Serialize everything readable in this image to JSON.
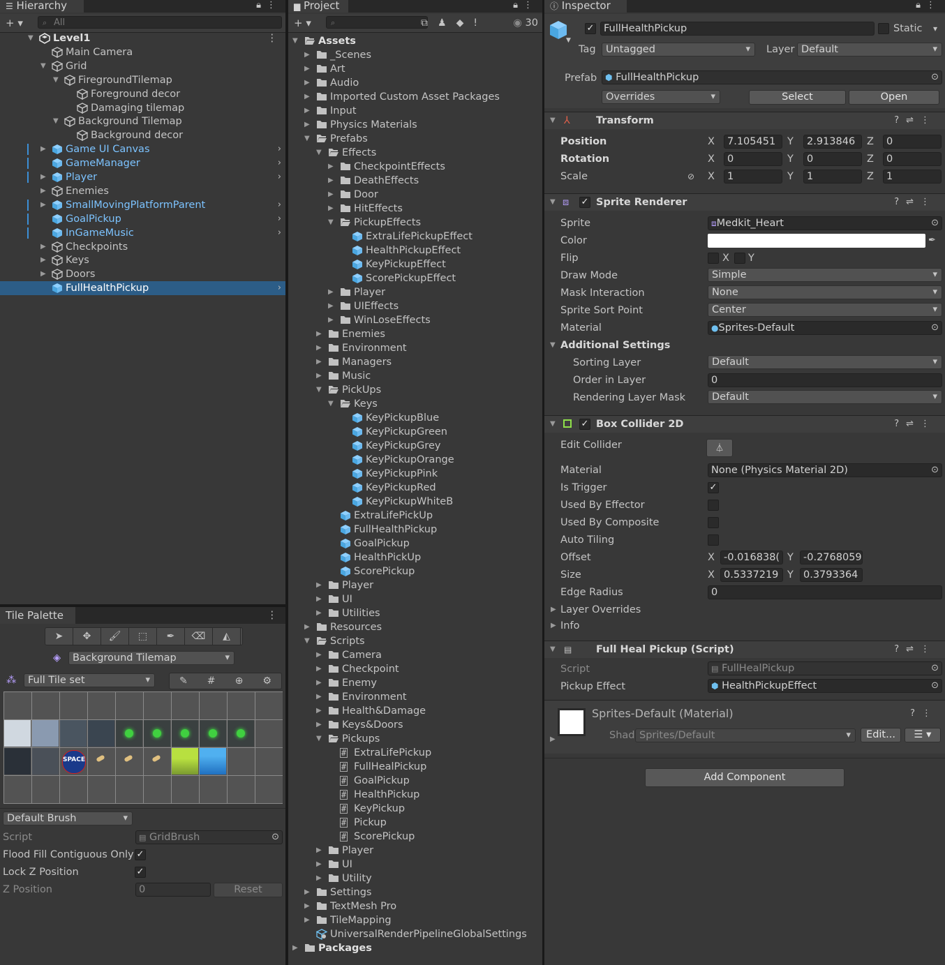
{
  "hierarchy": {
    "tab_title": "Hierarchy",
    "search_placeholder": "All",
    "items": [
      {
        "label": "Level1",
        "depth": 0,
        "arrow": "▼",
        "icon": "unity-scene-icon",
        "bold": true,
        "menu": true
      },
      {
        "label": "Main Camera",
        "depth": 1,
        "arrow": "",
        "icon": "gameobject-icon"
      },
      {
        "label": "Grid",
        "depth": 1,
        "arrow": "▼",
        "icon": "gameobject-icon"
      },
      {
        "label": "FiregroundTilemap",
        "depth": 2,
        "arrow": "▼",
        "icon": "gameobject-icon"
      },
      {
        "label": "Foreground decor",
        "depth": 3,
        "arrow": "",
        "icon": "gameobject-icon"
      },
      {
        "label": "Damaging tilemap",
        "depth": 3,
        "arrow": "",
        "icon": "gameobject-icon"
      },
      {
        "label": "Background Tilemap",
        "depth": 2,
        "arrow": "▼",
        "icon": "gameobject-icon"
      },
      {
        "label": "Background decor",
        "depth": 3,
        "arrow": "",
        "icon": "gameobject-icon"
      },
      {
        "label": "Game UI Canvas",
        "depth": 1,
        "arrow": "▶",
        "icon": "prefab-icon",
        "prefab": true,
        "chevron": true
      },
      {
        "label": "GameManager",
        "depth": 1,
        "arrow": "",
        "icon": "prefab-icon",
        "prefab": true,
        "chevron": true
      },
      {
        "label": "Player",
        "depth": 1,
        "arrow": "▶",
        "icon": "prefab-icon",
        "prefab": true,
        "chevron": true
      },
      {
        "label": "Enemies",
        "depth": 1,
        "arrow": "▶",
        "icon": "gameobject-icon"
      },
      {
        "label": "SmallMovingPlatformParent",
        "depth": 1,
        "arrow": "▶",
        "icon": "prefab-icon",
        "prefab": true,
        "chevron": true
      },
      {
        "label": "GoalPickup",
        "depth": 1,
        "arrow": "",
        "icon": "prefab-icon",
        "prefab": true,
        "chevron": true
      },
      {
        "label": "InGameMusic",
        "depth": 1,
        "arrow": "",
        "icon": "prefab-icon",
        "prefab": true,
        "chevron": true
      },
      {
        "label": "Checkpoints",
        "depth": 1,
        "arrow": "▶",
        "icon": "gameobject-icon"
      },
      {
        "label": "Keys",
        "depth": 1,
        "arrow": "▶",
        "icon": "gameobject-icon"
      },
      {
        "label": "Doors",
        "depth": 1,
        "arrow": "▶",
        "icon": "gameobject-icon"
      },
      {
        "label": "FullHealthPickup",
        "depth": 1,
        "arrow": "",
        "icon": "prefab-icon",
        "selected": true,
        "chevron": true
      }
    ]
  },
  "tile_palette": {
    "tab_title": "Tile Palette",
    "tools": [
      "select-tool-icon",
      "move-tool-icon",
      "paint-tool-icon",
      "box-fill-tool-icon",
      "picker-tool-icon",
      "eraser-tool-icon",
      "fill-tool-icon"
    ],
    "target_tilemap": "Background Tilemap",
    "palette_name": "Full Tile set",
    "brush": "Default Brush",
    "script_label": "Script",
    "script_value": "GridBrush",
    "flood_fill_label": "Flood Fill Contiguous Only",
    "flood_fill": true,
    "lock_z_label": "Lock Z Position",
    "lock_z": true,
    "z_position_label": "Z Position",
    "z_position": "0",
    "reset_label": "Reset",
    "tile_badge": "SPACE"
  },
  "project": {
    "tab_title": "Project",
    "visible_count": "30",
    "items": [
      {
        "label": "Assets",
        "depth": 0,
        "arrow": "▼",
        "type": "folder-open",
        "bold": true
      },
      {
        "label": "_Scenes",
        "depth": 1,
        "arrow": "▶",
        "type": "folder"
      },
      {
        "label": "Art",
        "depth": 1,
        "arrow": "▶",
        "type": "folder"
      },
      {
        "label": "Audio",
        "depth": 1,
        "arrow": "▶",
        "type": "folder"
      },
      {
        "label": "Imported Custom Asset Packages",
        "depth": 1,
        "arrow": "▶",
        "type": "folder"
      },
      {
        "label": "Input",
        "depth": 1,
        "arrow": "▶",
        "type": "folder"
      },
      {
        "label": "Physics Materials",
        "depth": 1,
        "arrow": "▶",
        "type": "folder"
      },
      {
        "label": "Prefabs",
        "depth": 1,
        "arrow": "▼",
        "type": "folder-open"
      },
      {
        "label": "Effects",
        "depth": 2,
        "arrow": "▼",
        "type": "folder-open"
      },
      {
        "label": "CheckpointEffects",
        "depth": 3,
        "arrow": "▶",
        "type": "folder"
      },
      {
        "label": "DeathEffects",
        "depth": 3,
        "arrow": "▶",
        "type": "folder"
      },
      {
        "label": "Door",
        "depth": 3,
        "arrow": "▶",
        "type": "folder"
      },
      {
        "label": "HitEffects",
        "depth": 3,
        "arrow": "▶",
        "type": "folder"
      },
      {
        "label": "PickupEffects",
        "depth": 3,
        "arrow": "▼",
        "type": "folder-open"
      },
      {
        "label": "ExtraLifePickupEffect",
        "depth": 4,
        "arrow": "",
        "type": "prefab"
      },
      {
        "label": "HealthPickupEffect",
        "depth": 4,
        "arrow": "",
        "type": "prefab"
      },
      {
        "label": "KeyPickupEffect",
        "depth": 4,
        "arrow": "",
        "type": "prefab"
      },
      {
        "label": "ScorePickupEffect",
        "depth": 4,
        "arrow": "",
        "type": "prefab"
      },
      {
        "label": "Player",
        "depth": 3,
        "arrow": "▶",
        "type": "folder"
      },
      {
        "label": "UIEffects",
        "depth": 3,
        "arrow": "▶",
        "type": "folder"
      },
      {
        "label": "WinLoseEffects",
        "depth": 3,
        "arrow": "▶",
        "type": "folder"
      },
      {
        "label": "Enemies",
        "depth": 2,
        "arrow": "▶",
        "type": "folder"
      },
      {
        "label": "Environment",
        "depth": 2,
        "arrow": "▶",
        "type": "folder"
      },
      {
        "label": "Managers",
        "depth": 2,
        "arrow": "▶",
        "type": "folder"
      },
      {
        "label": "Music",
        "depth": 2,
        "arrow": "▶",
        "type": "folder"
      },
      {
        "label": "PickUps",
        "depth": 2,
        "arrow": "▼",
        "type": "folder-open"
      },
      {
        "label": "Keys",
        "depth": 3,
        "arrow": "▼",
        "type": "folder-open"
      },
      {
        "label": "KeyPickupBlue",
        "depth": 4,
        "arrow": "",
        "type": "prefab"
      },
      {
        "label": "KeyPickupGreen",
        "depth": 4,
        "arrow": "",
        "type": "prefab"
      },
      {
        "label": "KeyPickupGrey",
        "depth": 4,
        "arrow": "",
        "type": "prefab"
      },
      {
        "label": "KeyPickupOrange",
        "depth": 4,
        "arrow": "",
        "type": "prefab"
      },
      {
        "label": "KeyPickupPink",
        "depth": 4,
        "arrow": "",
        "type": "prefab"
      },
      {
        "label": "KeyPickupRed",
        "depth": 4,
        "arrow": "",
        "type": "prefab"
      },
      {
        "label": "KeyPickupWhiteB",
        "depth": 4,
        "arrow": "",
        "type": "prefab"
      },
      {
        "label": "ExtraLifePickUp",
        "depth": 3,
        "arrow": "",
        "type": "prefab"
      },
      {
        "label": "FullHealthPickup",
        "depth": 3,
        "arrow": "",
        "type": "prefab"
      },
      {
        "label": "GoalPickup",
        "depth": 3,
        "arrow": "",
        "type": "prefab"
      },
      {
        "label": "HealthPickUp",
        "depth": 3,
        "arrow": "",
        "type": "prefab"
      },
      {
        "label": "ScorePickup",
        "depth": 3,
        "arrow": "",
        "type": "prefab"
      },
      {
        "label": "Player",
        "depth": 2,
        "arrow": "▶",
        "type": "folder"
      },
      {
        "label": "UI",
        "depth": 2,
        "arrow": "▶",
        "type": "folder"
      },
      {
        "label": "Utilities",
        "depth": 2,
        "arrow": "▶",
        "type": "folder"
      },
      {
        "label": "Resources",
        "depth": 1,
        "arrow": "▶",
        "type": "folder"
      },
      {
        "label": "Scripts",
        "depth": 1,
        "arrow": "▼",
        "type": "folder-open"
      },
      {
        "label": "Camera",
        "depth": 2,
        "arrow": "▶",
        "type": "folder"
      },
      {
        "label": "Checkpoint",
        "depth": 2,
        "arrow": "▶",
        "type": "folder"
      },
      {
        "label": "Enemy",
        "depth": 2,
        "arrow": "▶",
        "type": "folder"
      },
      {
        "label": "Environment",
        "depth": 2,
        "arrow": "▶",
        "type": "folder"
      },
      {
        "label": "Health&Damage",
        "depth": 2,
        "arrow": "▶",
        "type": "folder"
      },
      {
        "label": "Keys&Doors",
        "depth": 2,
        "arrow": "▶",
        "type": "folder"
      },
      {
        "label": "Pickups",
        "depth": 2,
        "arrow": "▼",
        "type": "folder-open"
      },
      {
        "label": "ExtraLifePickup",
        "depth": 3,
        "arrow": "",
        "type": "script"
      },
      {
        "label": "FullHealPickup",
        "depth": 3,
        "arrow": "",
        "type": "script"
      },
      {
        "label": "GoalPickup",
        "depth": 3,
        "arrow": "",
        "type": "script"
      },
      {
        "label": "HealthPickup",
        "depth": 3,
        "arrow": "",
        "type": "script"
      },
      {
        "label": "KeyPickup",
        "depth": 3,
        "arrow": "",
        "type": "script"
      },
      {
        "label": "Pickup",
        "depth": 3,
        "arrow": "",
        "type": "script"
      },
      {
        "label": "ScorePickup",
        "depth": 3,
        "arrow": "",
        "type": "script"
      },
      {
        "label": "Player",
        "depth": 2,
        "arrow": "▶",
        "type": "folder"
      },
      {
        "label": "UI",
        "depth": 2,
        "arrow": "▶",
        "type": "folder"
      },
      {
        "label": "Utility",
        "depth": 2,
        "arrow": "▶",
        "type": "folder"
      },
      {
        "label": "Settings",
        "depth": 1,
        "arrow": "▶",
        "type": "folder"
      },
      {
        "label": "TextMesh Pro",
        "depth": 1,
        "arrow": "▶",
        "type": "folder"
      },
      {
        "label": "TileMapping",
        "depth": 1,
        "arrow": "▶",
        "type": "folder"
      },
      {
        "label": "UniversalRenderPipelineGlobalSettings",
        "depth": 1,
        "arrow": "",
        "type": "asset"
      },
      {
        "label": "Packages",
        "depth": 0,
        "arrow": "▶",
        "type": "folder",
        "bold": true
      }
    ]
  },
  "inspector": {
    "tab_title": "Inspector",
    "object_name": "FullHealthPickup",
    "active": true,
    "static_label": "Static",
    "static": false,
    "tag_label": "Tag",
    "tag": "Untagged",
    "layer_label": "Layer",
    "layer": "Default",
    "prefab_label": "Prefab",
    "prefab_value": "FullHealthPickup",
    "overrides_label": "Overrides",
    "select_label": "Select",
    "open_label": "Open",
    "transform": {
      "title": "Transform",
      "position_label": "Position",
      "position": {
        "x": "7.105451",
        "y": "2.913846",
        "z": "0"
      },
      "rotation_label": "Rotation",
      "rotation": {
        "x": "0",
        "y": "0",
        "z": "0"
      },
      "scale_label": "Scale",
      "scale": {
        "x": "1",
        "y": "1",
        "z": "1"
      }
    },
    "sprite_renderer": {
      "title": "Sprite Renderer",
      "enabled": true,
      "sprite_label": "Sprite",
      "sprite": "Medkit_Heart",
      "color_label": "Color",
      "color": "#ffffff",
      "flip_label": "Flip",
      "flip_x_label": "X",
      "flip_y_label": "Y",
      "draw_mode_label": "Draw Mode",
      "draw_mode": "Simple",
      "mask_label": "Mask Interaction",
      "mask": "None",
      "sort_point_label": "Sprite Sort Point",
      "sort_point": "Center",
      "material_label": "Material",
      "material": "Sprites-Default",
      "additional_label": "Additional Settings",
      "sorting_layer_label": "Sorting Layer",
      "sorting_layer": "Default",
      "order_label": "Order in Layer",
      "order": "0",
      "rlm_label": "Rendering Layer Mask",
      "rlm": "Default"
    },
    "box_collider": {
      "title": "Box Collider 2D",
      "enabled": true,
      "edit_label": "Edit Collider",
      "material_label": "Material",
      "material": "None (Physics Material 2D)",
      "trigger_label": "Is Trigger",
      "trigger": true,
      "effector_label": "Used By Effector",
      "effector": false,
      "composite_label": "Used By Composite",
      "composite": false,
      "tiling_label": "Auto Tiling",
      "tiling": false,
      "offset_label": "Offset",
      "offset": {
        "x": "-0.016838(",
        "y": "-0.2768059"
      },
      "size_label": "Size",
      "size": {
        "x": "0.5337219",
        "y": "0.3793364"
      },
      "radius_label": "Edge Radius",
      "radius": "0",
      "layer_overrides_label": "Layer Overrides",
      "info_label": "Info"
    },
    "script": {
      "title": "Full Heal Pickup (Script)",
      "script_label": "Script",
      "script": "FullHealPickup",
      "effect_label": "Pickup Effect",
      "effect": "HealthPickupEffect"
    },
    "material": {
      "title": "Sprites-Default (Material)",
      "shader_label": "Shader",
      "shader": "Sprites/Default",
      "edit_label": "Edit..."
    },
    "add_component_label": "Add Component"
  }
}
